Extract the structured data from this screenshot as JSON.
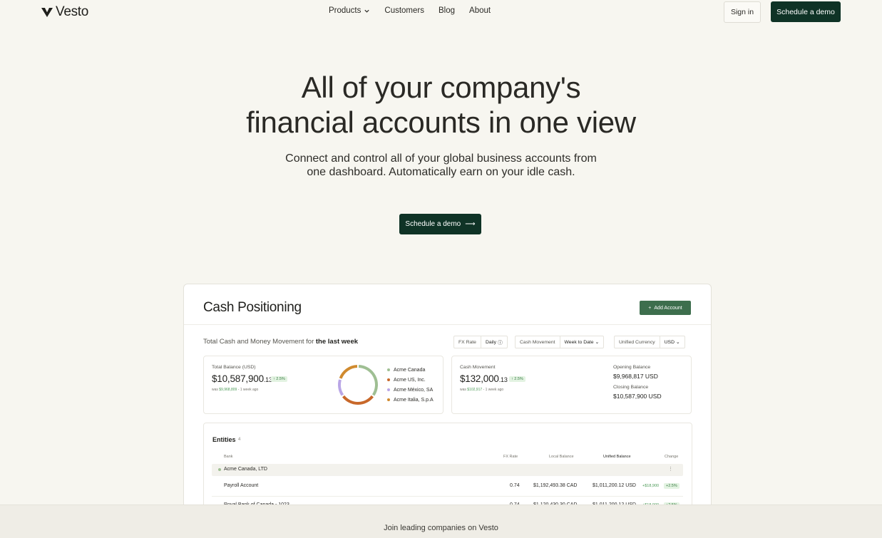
{
  "nav": {
    "brand": "Vesto",
    "menu": [
      {
        "label": "Products",
        "has_dropdown": true
      },
      {
        "label": "Customers"
      },
      {
        "label": "Blog"
      },
      {
        "label": "About"
      }
    ],
    "signin_label": "Sign in",
    "demo_label": "Schedule a demo"
  },
  "hero": {
    "title_line1": "All of your company's",
    "title_line2": "financial accounts in one view",
    "subtitle": "Connect and control all of your global business accounts from one dashboard. Automatically earn on your idle cash.",
    "cta_label": "Schedule a demo",
    "cta_arrow": "⟶"
  },
  "dashboard": {
    "title": "Cash Positioning",
    "add_account": "Add Account",
    "summary_prefix": "Total Cash and Money Movement for ",
    "summary_bold": "the last week",
    "controls": {
      "fx_label": "FX Rate",
      "fx_value": "Daily",
      "cm_label": "Cash Movement",
      "cm_value": "Week to Date",
      "uc_label": "Unified Currency",
      "uc_value": "USD"
    },
    "total_balance": {
      "label": "Total Balance (USD)",
      "value_main": "$10,587,900",
      "value_cents": ".13",
      "change": "↑ 2.5%",
      "was_prefix": "was ",
      "was_value": "$9,968,809",
      "was_suffix": " - 1 week ago"
    },
    "donut": {
      "slices": [
        {
          "name": "Acme Canada",
          "color": "#9fbf93",
          "share": 0.35
        },
        {
          "name": "Acme US, Inc.",
          "color": "#c8682a",
          "share": 0.3
        },
        {
          "name": "Acme México, SA",
          "color": "#b9a6e6",
          "share": 0.15
        },
        {
          "name": "Acme Italia, S.p.A",
          "color": "#d08a2e",
          "share": 0.2
        }
      ]
    },
    "cash_movement": {
      "label": "Cash Movement",
      "value_main": "$132,000",
      "value_cents": ".13",
      "change": "↑ 2.5%",
      "was_prefix": "was ",
      "was_value": "$102,917",
      "was_suffix": " - 1 week ago",
      "opening_label": "Opening Balance",
      "opening_value": "$9,968,817 USD",
      "closing_label": "Closing Balance",
      "closing_value": "$10,587,900 USD"
    },
    "entities": {
      "title": "Entities",
      "count": "4",
      "headers": {
        "bank": "Bank",
        "fx": "FX Rate",
        "local": "Local Balance",
        "unified": "Unified Balance",
        "change": "Change"
      },
      "group": "Acme Canada, LTD",
      "group_menu": "⋮",
      "rows": [
        {
          "bank": "Payroll Account",
          "fx": "0.74",
          "local": "$1,192,493.38 CAD",
          "unified": "$1,011,200.12 USD",
          "delta": "+$18,900",
          "pct": "+2.5%"
        },
        {
          "bank": "Royal Bank of Canada - 1023",
          "fx": "0.74",
          "local": "$1,120,430.30 CAD",
          "unified": "$1,011,200.12 USD",
          "delta": "+$18,900",
          "pct": "+2.5%"
        }
      ]
    }
  },
  "band": {
    "text": "Join leading companies on Vesto"
  },
  "colors": {
    "brand_dark": "#0f3326",
    "accent_green": "#3d6e4d",
    "background": "#f7f6f0"
  }
}
